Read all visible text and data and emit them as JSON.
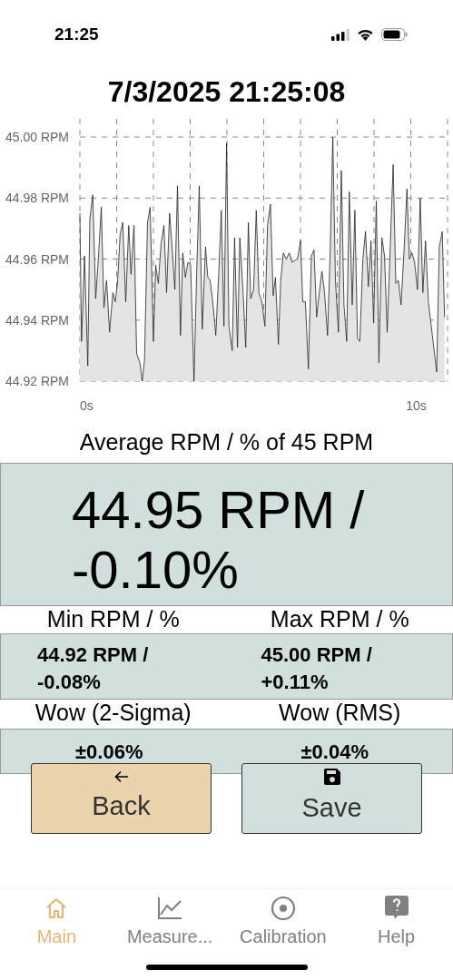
{
  "status_bar": {
    "time": "21:25"
  },
  "title": "7/3/2025 21:25:08",
  "chart": {
    "chart_data": {
      "type": "area",
      "grid": true,
      "xlim": [
        -0.22,
        10.93
      ],
      "ylim": [
        44.92,
        45.0
      ],
      "xticks": [
        {
          "value": 0,
          "label": "0s"
        },
        {
          "value": 10,
          "label": "10s"
        }
      ],
      "yticks": [
        {
          "value": 45.0,
          "label": "45.00 RPM"
        },
        {
          "value": 44.98,
          "label": "44.98 RPM"
        },
        {
          "value": 44.96,
          "label": "44.96 RPM"
        },
        {
          "value": 44.94,
          "label": "44.94 RPM"
        },
        {
          "value": 44.92,
          "label": "44.92 RPM"
        }
      ],
      "x": [
        -0.22,
        -0.17,
        -0.08,
        0.02,
        0.08,
        0.17,
        0.26,
        0.34,
        0.43,
        0.51,
        0.59,
        0.68,
        0.78,
        0.85,
        0.92,
        1.0,
        1.08,
        1.17,
        1.26,
        1.33,
        1.42,
        1.5,
        1.6,
        1.67,
        1.74,
        1.83,
        1.91,
        2.01,
        2.08,
        2.16,
        2.24,
        2.33,
        2.41,
        2.5,
        2.57,
        2.66,
        2.74,
        2.83,
        2.9,
        2.98,
        3.06,
        3.14,
        3.24,
        3.32,
        3.4,
        3.49,
        3.59,
        3.66,
        3.73,
        3.82,
        3.9,
        3.99,
        4.07,
        4.15,
        4.23,
        4.3,
        4.4,
        4.47,
        4.56,
        4.63,
        4.72,
        4.81,
        4.89,
        4.96,
        5.05,
        5.13,
        5.21,
        5.3,
        5.39,
        5.47,
        5.56,
        5.64,
        5.71,
        5.8,
        5.87,
        5.95,
        6.04,
        6.13,
        6.21,
        6.38,
        6.47,
        6.54,
        6.62,
        6.71,
        6.8,
        6.88,
        6.96,
        7.04,
        7.12,
        7.2,
        7.29,
        7.37,
        7.45,
        7.53,
        7.62,
        7.71,
        7.79,
        7.87,
        7.95,
        8.04,
        8.12,
        8.2,
        8.27,
        8.36,
        8.44,
        8.53,
        8.61,
        8.69,
        8.77,
        8.85,
        8.94,
        9.02,
        9.1,
        9.28,
        9.36,
        9.44,
        9.52,
        9.61,
        9.7,
        9.77,
        9.85,
        9.93,
        10.02,
        10.1,
        10.18,
        10.26,
        10.35,
        10.6,
        10.68,
        10.77,
        10.84
      ],
      "values": [
        44.975,
        44.933,
        44.961,
        44.925,
        44.973,
        44.981,
        44.947,
        44.96,
        44.977,
        44.944,
        44.953,
        44.936,
        44.949,
        44.946,
        44.952,
        44.968,
        44.972,
        44.946,
        44.971,
        44.955,
        44.971,
        44.929,
        44.926,
        44.92,
        44.927,
        44.972,
        44.977,
        44.933,
        44.958,
        44.952,
        44.965,
        44.971,
        44.949,
        44.975,
        44.965,
        44.95,
        44.984,
        44.935,
        44.962,
        44.954,
        44.959,
        44.958,
        44.92,
        44.955,
        44.984,
        44.937,
        44.964,
        44.954,
        44.953,
        44.945,
        44.935,
        44.955,
        44.976,
        44.938,
        44.998,
        44.938,
        44.93,
        44.967,
        44.931,
        44.967,
        44.951,
        44.931,
        44.972,
        44.947,
        44.95,
        44.976,
        44.949,
        44.946,
        44.938,
        44.971,
        44.978,
        44.948,
        44.954,
        44.932,
        44.953,
        44.962,
        44.96,
        44.962,
        44.959,
        44.96,
        44.966,
        44.946,
        44.946,
        44.924,
        44.961,
        44.963,
        44.941,
        44.949,
        44.956,
        44.949,
        44.935,
        44.962,
        45.0,
        44.953,
        44.936,
        44.989,
        44.945,
        44.933,
        44.982,
        44.945,
        44.976,
        44.934,
        44.933,
        44.96,
        44.969,
        44.951,
        44.966,
        44.939,
        44.979,
        44.926,
        44.967,
        44.961,
        44.936,
        44.991,
        44.952,
        44.953,
        44.945,
        44.963,
        44.983,
        44.96,
        44.962,
        44.959,
        44.95,
        44.98,
        44.949,
        44.966,
        44.946,
        44.923,
        44.964,
        44.969,
        44.941
      ]
    }
  },
  "average": {
    "label": "Average RPM / % of 45 RPM",
    "value": "44.95 RPM / -0.10%"
  },
  "pairs": [
    {
      "left_label": "Min RPM / %",
      "right_label": "Max RPM / %",
      "left_value": "44.92 RPM / -0.08%",
      "right_value": "45.00 RPM / +0.11%"
    },
    {
      "left_label": "Wow (2-Sigma)",
      "right_label": "Wow (RMS)",
      "left_value": "±0.06%",
      "right_value": "±0.04%"
    }
  ],
  "buttons": [
    {
      "label": "Back",
      "kind": "back"
    },
    {
      "label": "Save",
      "kind": "save"
    }
  ],
  "tabs": [
    {
      "label": "Main",
      "kind": "home",
      "selected": true
    },
    {
      "label": "Measure...",
      "kind": "chart",
      "selected": false
    },
    {
      "label": "Calibration",
      "kind": "target",
      "selected": false
    },
    {
      "label": "Help",
      "kind": "help",
      "selected": false
    }
  ]
}
